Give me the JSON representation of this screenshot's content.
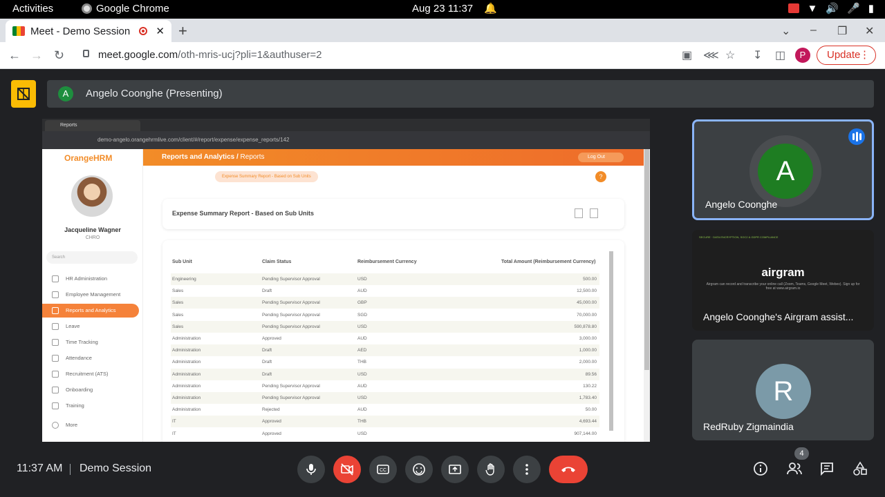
{
  "system": {
    "activities": "Activities",
    "app_name": "Google Chrome",
    "clock": "Aug 23  11:37"
  },
  "browser": {
    "tab_title": "Meet - Demo Session",
    "url_host": "meet.google.com",
    "url_path": "/oth-mris-ucj?pli=1&authuser=2",
    "profile_initial": "P",
    "update_label": "Update"
  },
  "presenter_bar": {
    "avatar": "A",
    "label": "Angelo Coonghe (Presenting)"
  },
  "shared": {
    "tab_title": "Reports",
    "url": "demo-angelo.orangehrmlive.com/client/#/report/expense/expense_reports/142",
    "logo": "OrangeHRM",
    "user_name": "Jacqueline Wagner",
    "user_role": "CHRO",
    "search_placeholder": "Search",
    "menu": [
      "HR Administration",
      "Employee Management",
      "Reports and Analytics",
      "Leave",
      "Time Tracking",
      "Attendance",
      "Recruitment (ATS)",
      "Onboarding",
      "Training",
      "More"
    ],
    "header_main": "Reports and Analytics / ",
    "header_sub": "Reports",
    "logout": "Log Out",
    "breadcrumb": "Expense Summary Report - Based on Sub Units",
    "report_title": "Expense Summary Report - Based on Sub Units",
    "columns": [
      "Sub Unit",
      "Claim Status",
      "Reimbursement Currency",
      "Total Amount (Reimbursement Currency)"
    ],
    "rows": [
      [
        "Engineering",
        "Pending Supervisor Approval",
        "USD",
        "500.00"
      ],
      [
        "Sales",
        "Draft",
        "AUD",
        "12,500.00"
      ],
      [
        "Sales",
        "Pending Supervisor Approval",
        "GBP",
        "45,000.00"
      ],
      [
        "Sales",
        "Pending Supervisor Approval",
        "SGD",
        "70,000.00"
      ],
      [
        "Sales",
        "Pending Supervisor Approval",
        "USD",
        "590,878.80"
      ],
      [
        "Administration",
        "Approved",
        "AUD",
        "3,000.00"
      ],
      [
        "Administration",
        "Draft",
        "AED",
        "1,000.00"
      ],
      [
        "Administration",
        "Draft",
        "THB",
        "2,000.00"
      ],
      [
        "Administration",
        "Draft",
        "USD",
        "89.56"
      ],
      [
        "Administration",
        "Pending Supervisor Approval",
        "AUD",
        "130.22"
      ],
      [
        "Administration",
        "Pending Supervisor Approval",
        "USD",
        "1,783.40"
      ],
      [
        "Administration",
        "Rejected",
        "AUD",
        "50.00"
      ],
      [
        "IT",
        "Approved",
        "THB",
        "4,693.44"
      ],
      [
        "IT",
        "Approved",
        "USD",
        "907,144.00"
      ]
    ]
  },
  "participants": [
    {
      "initial": "A",
      "name": "Angelo Coonghe",
      "color": "#1e7d22"
    },
    {
      "brand": "airgram",
      "name": "Angelo Coonghe's Airgram assist...",
      "sub": "Airgram can record and transcribe your online call (Zoom, Teams, Google Meet, Webex). Sign up for free at www.airgram.io",
      "top": "SECURE · DATA ENCRYPTION, SOC2 & GDPR COMPLIANCE"
    },
    {
      "initial": "R",
      "name": "RedRuby Zigmaindia",
      "color": "#7b9aa8"
    }
  ],
  "bottom": {
    "time": "11:37 AM",
    "meeting": "Demo Session",
    "people_count": "4"
  }
}
